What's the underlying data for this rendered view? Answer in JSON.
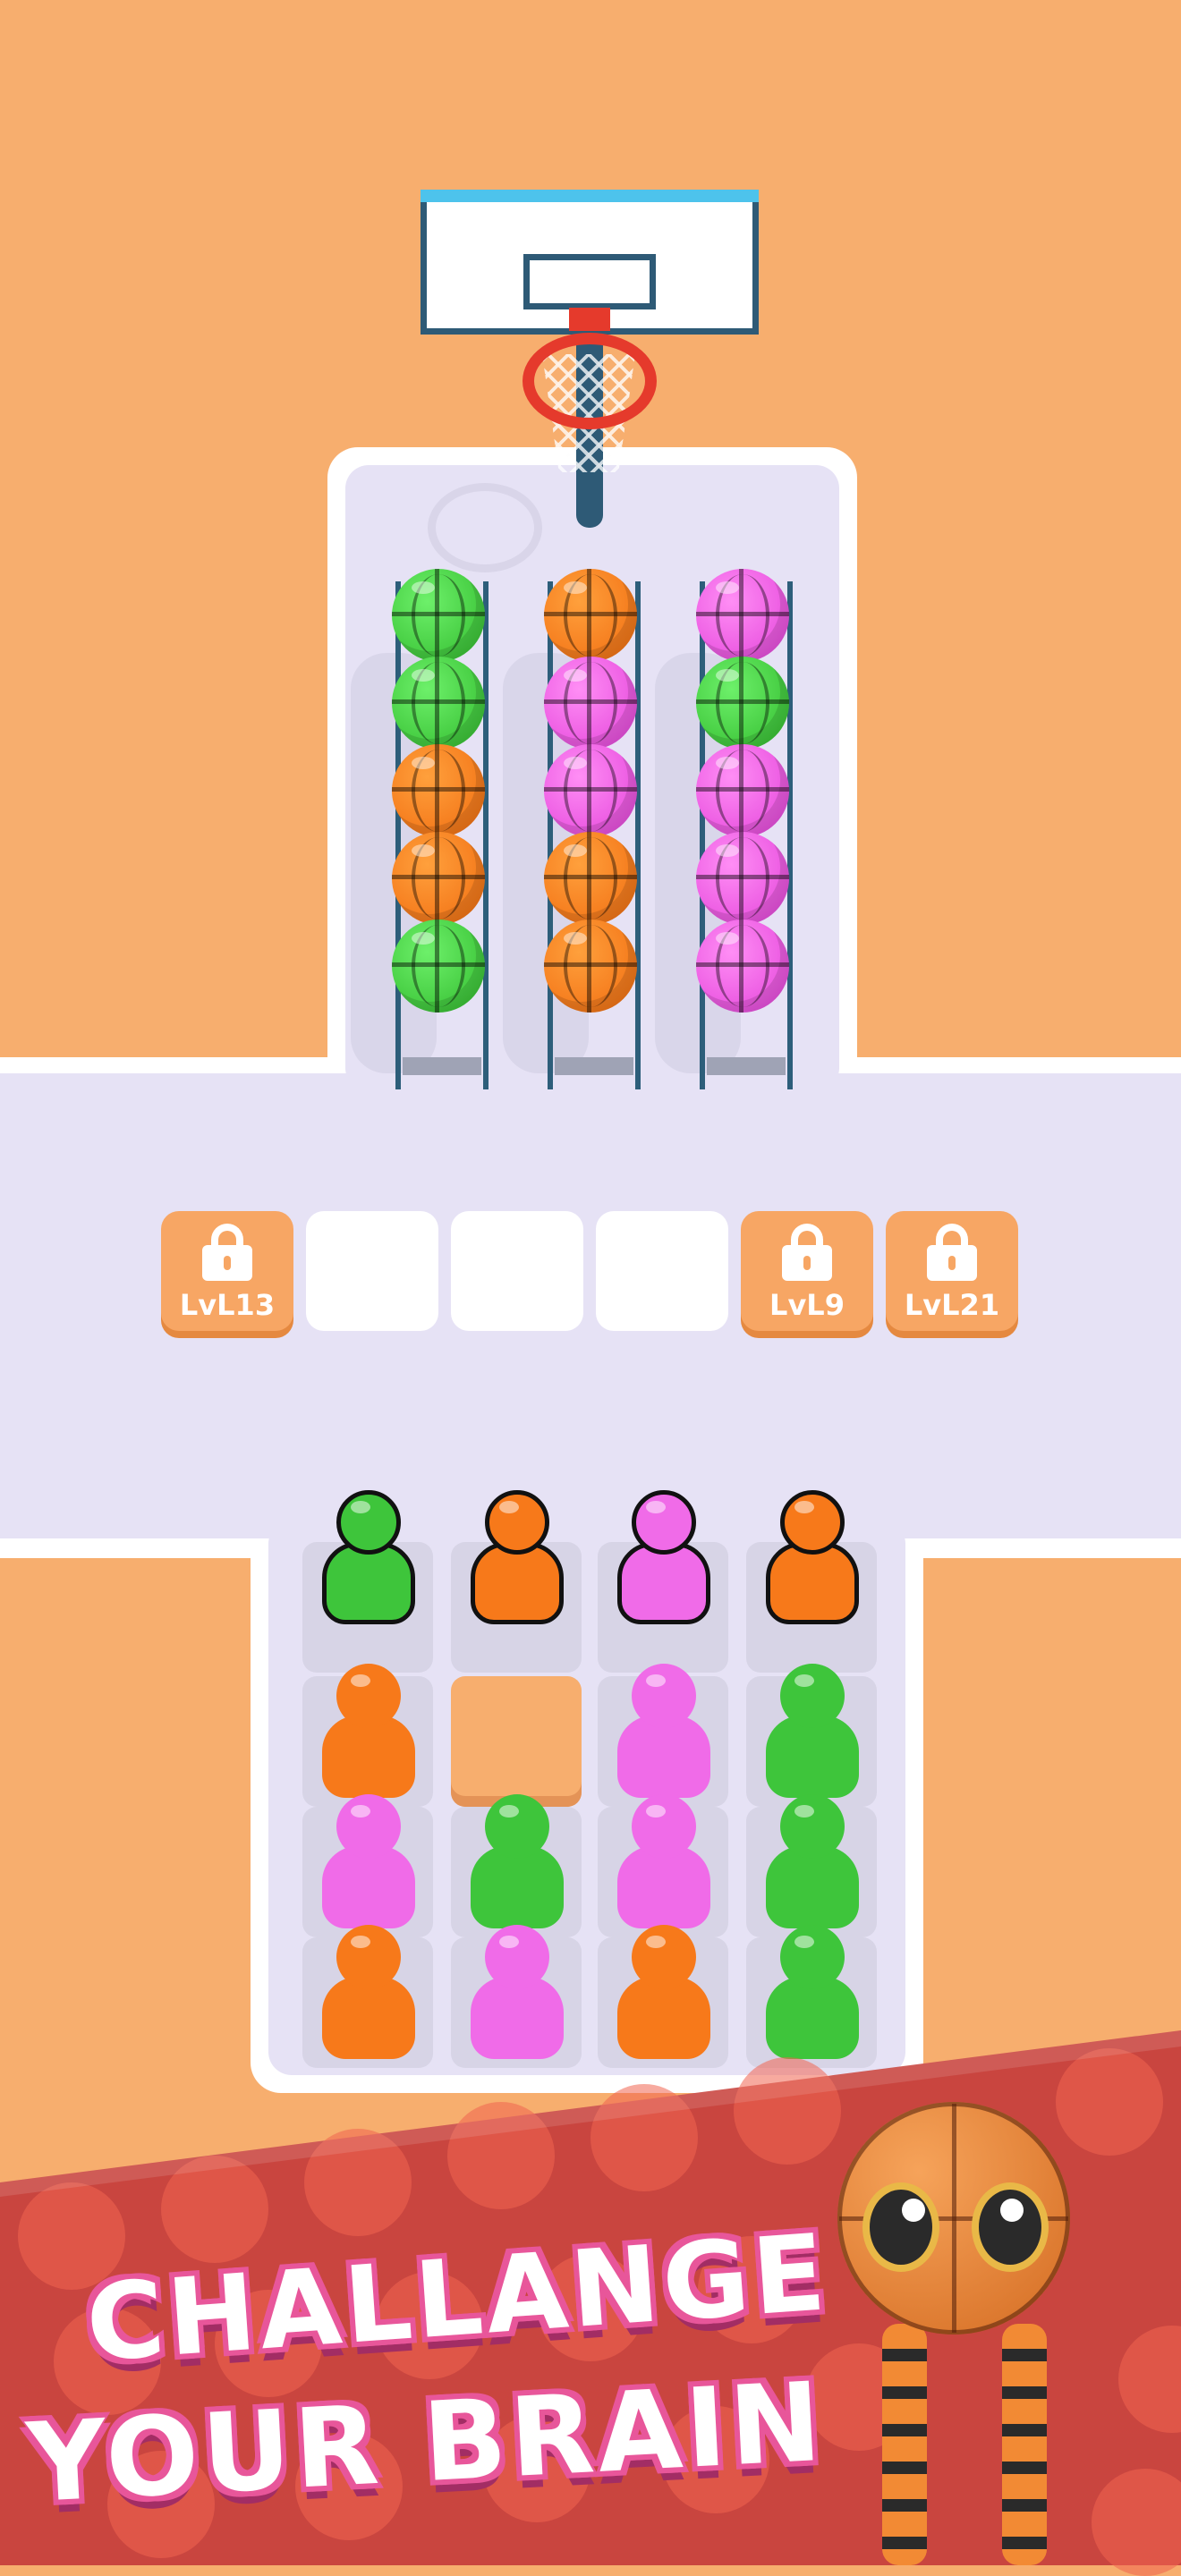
{
  "game": {
    "tubes": [
      {
        "balls": [
          "green",
          "green",
          "orange",
          "orange",
          "green"
        ]
      },
      {
        "balls": [
          "orange",
          "pink",
          "pink",
          "orange",
          "orange"
        ]
      },
      {
        "balls": [
          "pink",
          "green",
          "pink",
          "pink",
          "pink"
        ]
      }
    ],
    "slots": [
      {
        "state": "locked",
        "label": "LvL13"
      },
      {
        "state": "empty",
        "label": ""
      },
      {
        "state": "empty",
        "label": ""
      },
      {
        "state": "empty",
        "label": ""
      },
      {
        "state": "locked",
        "label": "LvL9"
      },
      {
        "state": "locked",
        "label": "LvL21"
      }
    ],
    "crowd_rows": [
      [
        "green",
        "orange",
        "pink",
        "orange"
      ],
      [
        "orange",
        "empty",
        "pink",
        "green"
      ],
      [
        "pink",
        "green",
        "pink",
        "green"
      ],
      [
        "orange",
        "pink",
        "orange",
        "green"
      ]
    ]
  },
  "banner": {
    "line1": "CHALLANGE",
    "line2": "YOUR BRAIN"
  },
  "colors": {
    "background": "#F7AE6E",
    "board": "#E6E2F5",
    "green": "#3EC53B",
    "orange": "#F7791A",
    "pink": "#F06BE8",
    "banner": "#C9453F"
  },
  "icons": {
    "lock": "lock-icon",
    "hoop": "basketball-hoop",
    "mascot": "basketball-mascot"
  }
}
